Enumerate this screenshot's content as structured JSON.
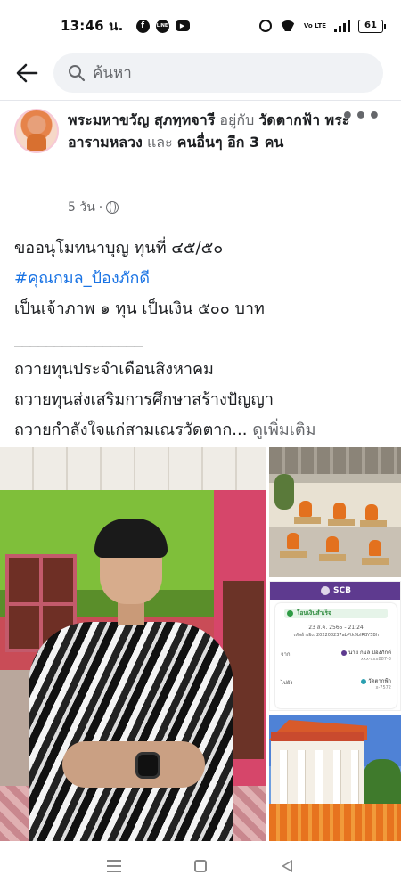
{
  "status_bar": {
    "time": "13:46 น.",
    "apps": [
      "facebook-icon",
      "line-icon",
      "youtube-icon"
    ],
    "volte": "Vo LTE",
    "battery": "61"
  },
  "search": {
    "placeholder": "ค้นหา"
  },
  "post": {
    "author": "พระมหาขวัญ สุภทฺทจารี",
    "with_label": "อยู่กับ",
    "tagged_page": "วัดตากฟ้า พระอารามหลวง",
    "and_label": "และ",
    "others": "คนอื่นๆ อีก 3 คน",
    "time": "5 วัน",
    "privacy_icon": "globe-icon",
    "body": {
      "line1": "ขออนุโมทนาบุญ ทุนที่ ๔๕/๕๐",
      "hashtag": "#คุณกมล_ป้องภักดี",
      "line3": "เป็นเจ้าภาพ ๑ ทุน เป็นเงิน ๕๐๐ บาท",
      "separator": "________________",
      "line5": "ถวายทุนประจำเดือนสิงหาคม",
      "line6": "ถวายทุนส่งเสริมการศึกษาสร้างปัญญา",
      "line7": "ถวายกำลังใจแก่สามเณรวัดตาก...",
      "see_more": "ดูเพิ่มเติม"
    }
  },
  "receipt": {
    "bank": "SCB",
    "status": "โอนเงินสำเร็จ",
    "date": "23 ส.ค. 2565 - 21:24",
    "ref": "รหัสอ้างอิง: 202208237abPtk9bIRBY5Bh",
    "from_label": "จาก",
    "from_name": "นาย กมล ป้องภักดี",
    "from_acct": "xxx-xxx887-3",
    "to_label": "ไปยัง",
    "to_name": "วัดตากฟ้า",
    "to_acct": "x-7572"
  },
  "colors": {
    "link_blue": "#1b74e4",
    "muted_gray": "#65676b",
    "search_bg": "#f0f2f5",
    "scb_purple": "#5e3a8f"
  }
}
